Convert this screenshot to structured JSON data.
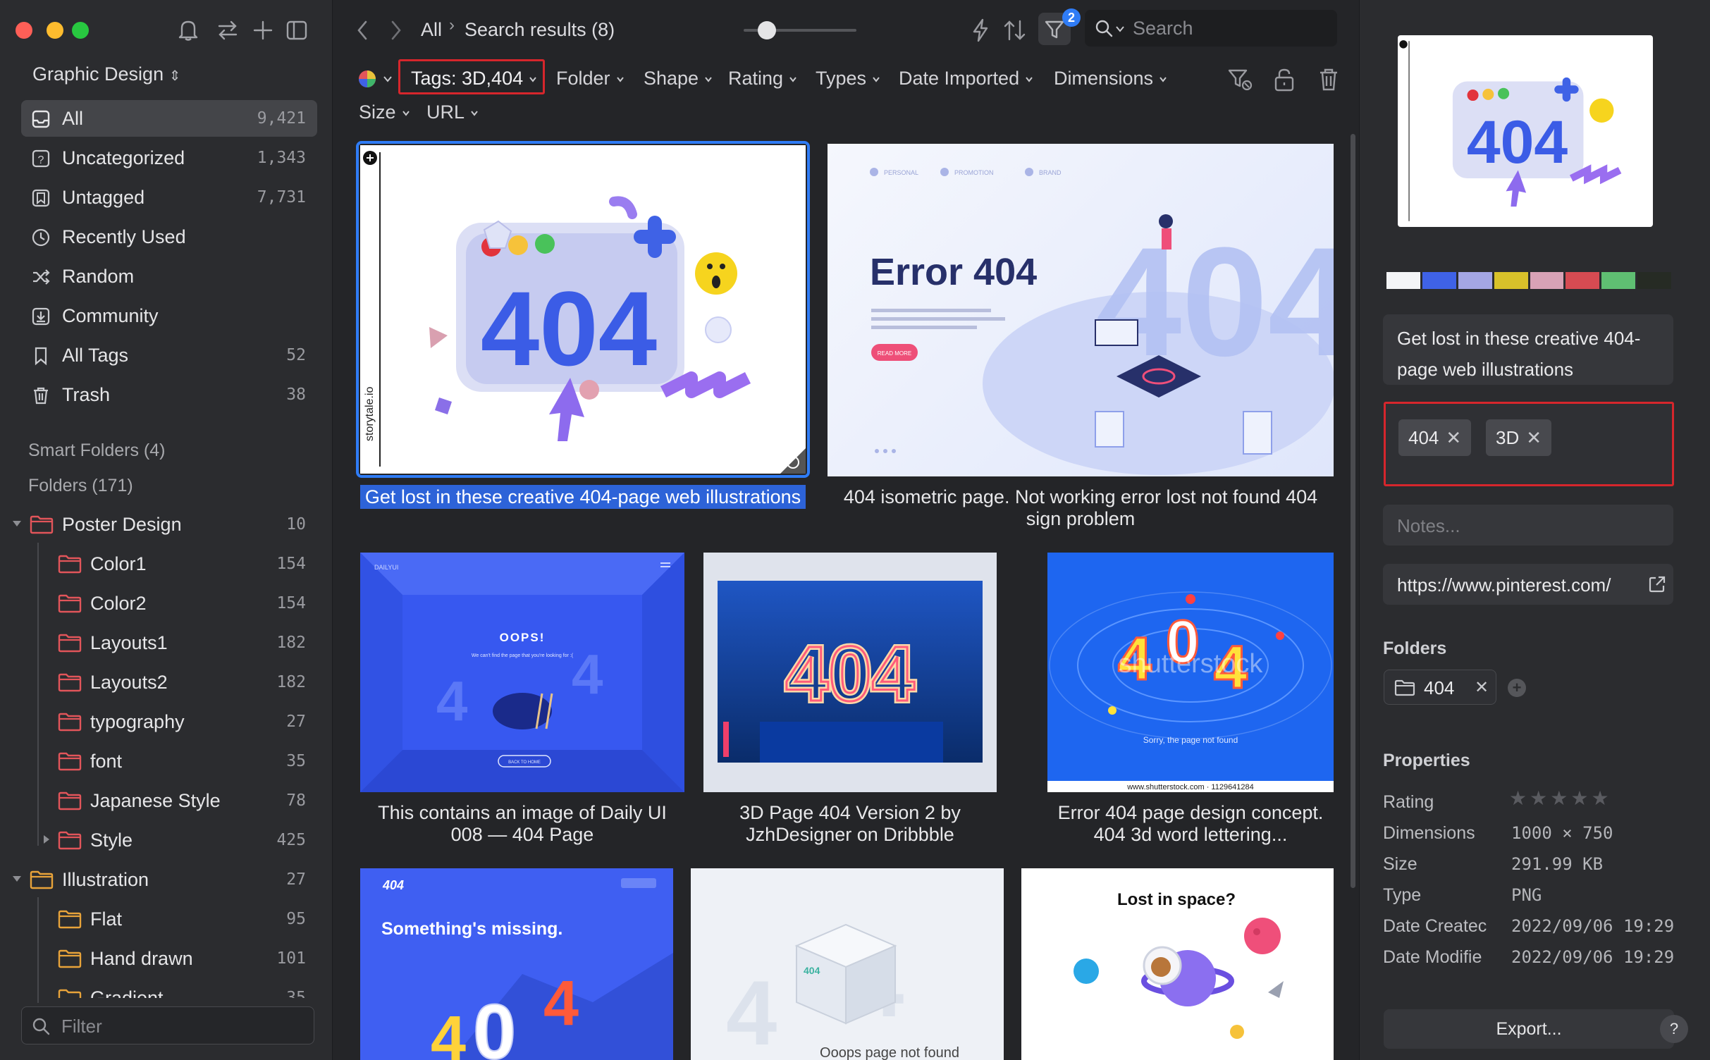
{
  "sidebar": {
    "library_name": "Graphic Design",
    "nav": [
      {
        "label": "All",
        "count": "9,421"
      },
      {
        "label": "Uncategorized",
        "count": "1,343"
      },
      {
        "label": "Untagged",
        "count": "7,731"
      },
      {
        "label": "Recently Used",
        "count": ""
      },
      {
        "label": "Random",
        "count": ""
      },
      {
        "label": "Community",
        "count": ""
      },
      {
        "label": "All Tags",
        "count": "52"
      },
      {
        "label": "Trash",
        "count": "38"
      }
    ],
    "smart_folders": "Smart Folders (4)",
    "folders_header": "Folders (171)",
    "folders": [
      {
        "label": "Poster Design",
        "count": "10"
      },
      {
        "label": "Color1",
        "count": "154"
      },
      {
        "label": "Color2",
        "count": "154"
      },
      {
        "label": "Layouts1",
        "count": "182"
      },
      {
        "label": "Layouts2",
        "count": "182"
      },
      {
        "label": "typography",
        "count": "27"
      },
      {
        "label": "font",
        "count": "35"
      },
      {
        "label": "Japanese Style",
        "count": "78"
      },
      {
        "label": "Style",
        "count": "425"
      },
      {
        "label": "Illustration",
        "count": "27"
      },
      {
        "label": "Flat",
        "count": "95"
      },
      {
        "label": "Hand drawn",
        "count": "101"
      },
      {
        "label": "Gradient",
        "count": "35"
      }
    ],
    "filter_placeholder": "Filter"
  },
  "toolbar": {
    "breadcrumb_root": "All",
    "breadcrumb_current": "Search results (8)",
    "filter_badge": "2",
    "search_placeholder": "Search",
    "filters": {
      "tags": "Tags: 3D,404",
      "folder": "Folder",
      "shape": "Shape",
      "rating": "Rating",
      "types": "Types",
      "date_imported": "Date Imported",
      "dimensions": "Dimensions",
      "size": "Size",
      "url": "URL"
    }
  },
  "grid": {
    "items": [
      {
        "caption": "Get lost in these creative 404-page web illustrations",
        "source": "storytale.io"
      },
      {
        "caption": "404 isometric page. Not working error lost not found 404 sign problem",
        "title": "Error 404",
        "tabs": [
          "PERSONAL",
          "PROMOTION",
          "BRAND"
        ],
        "button": "READ MORE"
      },
      {
        "caption": "This contains an image of Daily UI 008 — 404 Page",
        "title": "OOPS!",
        "subtitle": "We can't find the page that you're looking for :(",
        "button": "BACK TO HOME",
        "logo": "DAILYUI"
      },
      {
        "caption": "3D Page 404 Version 2 by JzhDesigner on Dribbble",
        "art": "404"
      },
      {
        "caption": "Error 404 page design concept. 404 3d word lettering...",
        "watermark": "shutterstock",
        "subtitle": "Sorry, the page not found",
        "footer": "www.shutterstock.com · 1129641284"
      },
      {
        "caption": "",
        "title": "Something's missing.",
        "tag": "404"
      },
      {
        "caption": "",
        "title": "Ooops page not found",
        "box_label": "404"
      },
      {
        "caption": "",
        "title": "Lost in space?"
      }
    ]
  },
  "inspector": {
    "palette": [
      "#f4f5f7",
      "#3f62e6",
      "#a4a6e4",
      "#d8c12a",
      "#d8a2b6",
      "#d64b52",
      "#5fbf72",
      "#262b24"
    ],
    "title": "Get lost in these creative 404-page web illustrations",
    "tags": [
      "404",
      "3D"
    ],
    "notes_placeholder": "Notes...",
    "url": "https://www.pinterest.com/",
    "folders_header": "Folders",
    "folder": "404",
    "properties_header": "Properties",
    "rating": 0,
    "props": [
      {
        "label": "Rating",
        "value": ""
      },
      {
        "label": "Dimensions",
        "value": "1000 × 750"
      },
      {
        "label": "Size",
        "value": "291.99 KB"
      },
      {
        "label": "Type",
        "value": "PNG"
      },
      {
        "label": "Date Createc",
        "value": "2022/09/06 19:29"
      },
      {
        "label": "Date Modifie",
        "value": "2022/09/06 19:29"
      }
    ],
    "export_label": "Export...",
    "help_label": "?"
  },
  "colors": {
    "accent": "#2f7cf6",
    "highlight": "#d6262c",
    "selection": "#2d63d8"
  }
}
